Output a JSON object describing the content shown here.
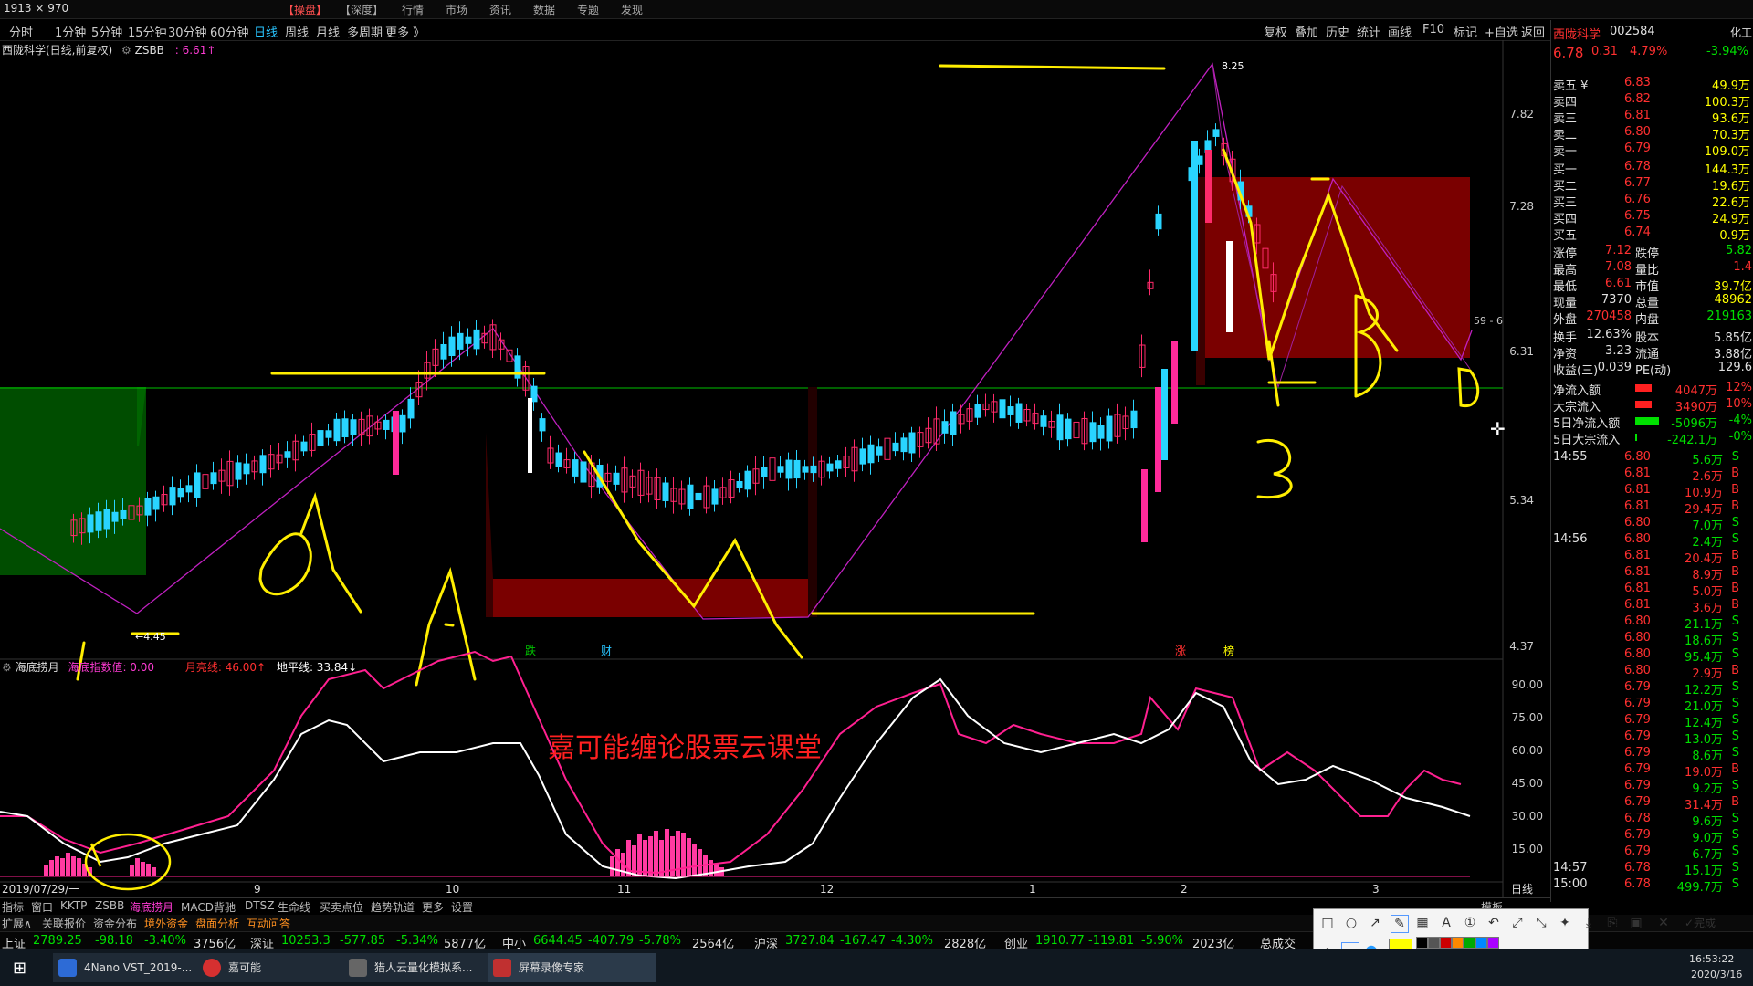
{
  "top_menu": {
    "resolution": "1913 × 970",
    "items": [
      "【操盘】",
      "【深度】",
      "行情",
      "市场",
      "资讯",
      "数据",
      "专题",
      "发现"
    ]
  },
  "toolbar": {
    "periods": [
      "分时",
      "1分钟",
      "5分钟",
      "15分钟",
      "30分钟",
      "60分钟",
      "日线",
      "周线",
      "月线",
      "多周期",
      "更多 》"
    ],
    "active": "日线",
    "right_items": [
      "复权",
      "叠加",
      "历史",
      "统计",
      "画线",
      "F10",
      "标记",
      "+自选",
      "返回"
    ]
  },
  "chart_title": {
    "name": "西陇科学(日线,前复权)",
    "indicator": "ZSBB",
    "value": ": 6.61↑"
  },
  "main_chart": {
    "y_ticks": [
      "7.82",
      "7.28",
      "6.31",
      "5.34",
      "4.37"
    ],
    "high_label": "8.25",
    "low_label": "←4.45",
    "side_label": "59 - 6",
    "markers": [
      "跌",
      "财",
      "涨",
      "榜"
    ]
  },
  "sub_chart": {
    "name": "海底捞月",
    "labels": [
      "海底指数值: 0.00",
      "月亮线: 46.00↑",
      "地平线: 33.84↓"
    ],
    "y_ticks": [
      "90.00",
      "75.00",
      "60.00",
      "45.00",
      "30.00",
      "15.00"
    ],
    "watermark": "嘉可能缠论股票云课堂"
  },
  "x_axis": {
    "start": "2019/07/29/一",
    "months": [
      "9",
      "10",
      "11",
      "12",
      "1",
      "2",
      "3"
    ],
    "period": "日线"
  },
  "handwriting": [
    "A",
    "A",
    "3",
    "B",
    "D"
  ],
  "right_panel": {
    "stock_name": "西陇科学",
    "code": "002584",
    "sector": "化工",
    "price": "6.78",
    "change": "0.31",
    "pct": "4.79%",
    "pct2": "-3.94%",
    "sells": [
      {
        "label": "卖五 ¥",
        "price": "6.83",
        "vol": "49.9万"
      },
      {
        "label": "卖四",
        "price": "6.82",
        "vol": "100.3万"
      },
      {
        "label": "卖三",
        "price": "6.81",
        "vol": "93.6万"
      },
      {
        "label": "卖二",
        "price": "6.80",
        "vol": "70.3万"
      },
      {
        "label": "卖一",
        "price": "6.79",
        "vol": "109.0万"
      }
    ],
    "buys": [
      {
        "label": "买一",
        "price": "6.78",
        "vol": "144.3万"
      },
      {
        "label": "买二",
        "price": "6.77",
        "vol": "19.6万"
      },
      {
        "label": "买三",
        "price": "6.76",
        "vol": "22.6万"
      },
      {
        "label": "买四",
        "price": "6.75",
        "vol": "24.9万"
      },
      {
        "label": "买五",
        "price": "6.74",
        "vol": "0.9万"
      }
    ],
    "stats": [
      {
        "k1": "涨停",
        "v1": "7.12",
        "k2": "跌停",
        "v2": "5.82"
      },
      {
        "k1": "最高",
        "v1": "7.08",
        "k2": "量比",
        "v2": "1.4"
      },
      {
        "k1": "最低",
        "v1": "6.61",
        "k2": "市值",
        "v2": "39.7亿"
      },
      {
        "k1": "现量",
        "v1": "7370",
        "k2": "总量",
        "v2": "48962"
      },
      {
        "k1": "外盘",
        "v1": "270458",
        "k2": "内盘",
        "v2": "219163"
      }
    ],
    "stats2": [
      {
        "k1": "换手",
        "v1": "12.63%",
        "k2": "股本",
        "v2": "5.85亿"
      },
      {
        "k1": "净资",
        "v1": "3.23",
        "k2": "流通",
        "v2": "3.88亿"
      },
      {
        "k1": "收益(三)",
        "v1": "0.039",
        "k2": "PE(动)",
        "v2": "129.6"
      }
    ],
    "flows": [
      {
        "label": "净流入额",
        "value": "4047万",
        "pct": "12%"
      },
      {
        "label": "大宗流入",
        "value": "3490万",
        "pct": "10%"
      },
      {
        "label": "5日净流入额",
        "value": "-5096万",
        "pct": "-4%"
      },
      {
        "label": "5日大宗流入",
        "value": "-242.1万",
        "pct": "-0%"
      }
    ],
    "ticks": [
      {
        "time": "14:55",
        "price": "6.80",
        "vol": "5.6万",
        "bs": "S"
      },
      {
        "time": "",
        "price": "6.81",
        "vol": "2.6万",
        "bs": "B"
      },
      {
        "time": "",
        "price": "6.81",
        "vol": "10.9万",
        "bs": "B"
      },
      {
        "time": "",
        "price": "6.81",
        "vol": "29.4万",
        "bs": "B"
      },
      {
        "time": "",
        "price": "6.80",
        "vol": "7.0万",
        "bs": "S"
      },
      {
        "time": "14:56",
        "price": "6.80",
        "vol": "2.4万",
        "bs": "S"
      },
      {
        "time": "",
        "price": "6.81",
        "vol": "20.4万",
        "bs": "B"
      },
      {
        "time": "",
        "price": "6.81",
        "vol": "8.9万",
        "bs": "B"
      },
      {
        "time": "",
        "price": "6.81",
        "vol": "5.0万",
        "bs": "B"
      },
      {
        "time": "",
        "price": "6.81",
        "vol": "3.6万",
        "bs": "B"
      },
      {
        "time": "",
        "price": "6.80",
        "vol": "21.1万",
        "bs": "S"
      },
      {
        "time": "",
        "price": "6.80",
        "vol": "18.6万",
        "bs": "S"
      },
      {
        "time": "",
        "price": "6.80",
        "vol": "95.4万",
        "bs": "S"
      },
      {
        "time": "",
        "price": "6.80",
        "vol": "2.9万",
        "bs": "B"
      },
      {
        "time": "",
        "price": "6.79",
        "vol": "12.2万",
        "bs": "S"
      },
      {
        "time": "",
        "price": "6.79",
        "vol": "21.0万",
        "bs": "S"
      },
      {
        "time": "",
        "price": "6.79",
        "vol": "12.4万",
        "bs": "S"
      },
      {
        "time": "",
        "price": "6.79",
        "vol": "13.0万",
        "bs": "S"
      },
      {
        "time": "",
        "price": "6.79",
        "vol": "8.6万",
        "bs": "S"
      },
      {
        "time": "",
        "price": "6.79",
        "vol": "19.0万",
        "bs": "B"
      },
      {
        "time": "",
        "price": "6.79",
        "vol": "9.2万",
        "bs": "S"
      },
      {
        "time": "",
        "price": "6.79",
        "vol": "31.4万",
        "bs": "B"
      },
      {
        "time": "",
        "price": "6.78",
        "vol": "9.6万",
        "bs": "S"
      },
      {
        "time": "",
        "price": "6.79",
        "vol": "9.0万",
        "bs": "S"
      },
      {
        "time": "",
        "price": "6.79",
        "vol": "6.7万",
        "bs": "S"
      },
      {
        "time": "14:57",
        "price": "6.78",
        "vol": "15.1万",
        "bs": "S"
      },
      {
        "time": "15:00",
        "price": "6.78",
        "vol": "499.7万",
        "bs": "S"
      }
    ]
  },
  "tabs": [
    "指标",
    "窗口",
    "KKTP",
    "ZSBB",
    "海底捞月",
    "MACD背驰",
    "DTSZ",
    "生命线",
    "买卖点位",
    "趋势轨道",
    "更多",
    "设置"
  ],
  "tabs_right": "模板",
  "ext_bar": [
    "扩展∧",
    "关联报价",
    "资金分布",
    "境外资金",
    "盘面分析",
    "互动问答"
  ],
  "index_bar": [
    {
      "name": "上证",
      "val": "2789.25",
      "chg": "-98.18",
      "pct": "-3.40%",
      "amt": "3756亿"
    },
    {
      "name": "深证",
      "val": "10253.3",
      "chg": "-577.85",
      "pct": "-5.34%",
      "amt": "5877亿"
    },
    {
      "name": "中小",
      "val": "6644.45",
      "chg": "-407.79",
      "pct": "-5.78%",
      "amt": "2564亿"
    },
    {
      "name": "沪深",
      "val": "3727.84",
      "chg": "-167.47",
      "pct": "-4.30%",
      "amt": "2828亿"
    },
    {
      "name": "创业",
      "val": "1910.77",
      "chg": "-119.81",
      "pct": "-5.90%",
      "amt": "2023亿"
    }
  ],
  "index_total": "总成交",
  "taskbar": {
    "apps": [
      "4Nano VST_2019-...",
      "嘉可能",
      "猎人云量化模拟系...",
      "屏幕录像专家"
    ],
    "time": "16:53:22",
    "date": "2020/3/16"
  },
  "draw_toolbar": {
    "done_label": "完成"
  }
}
